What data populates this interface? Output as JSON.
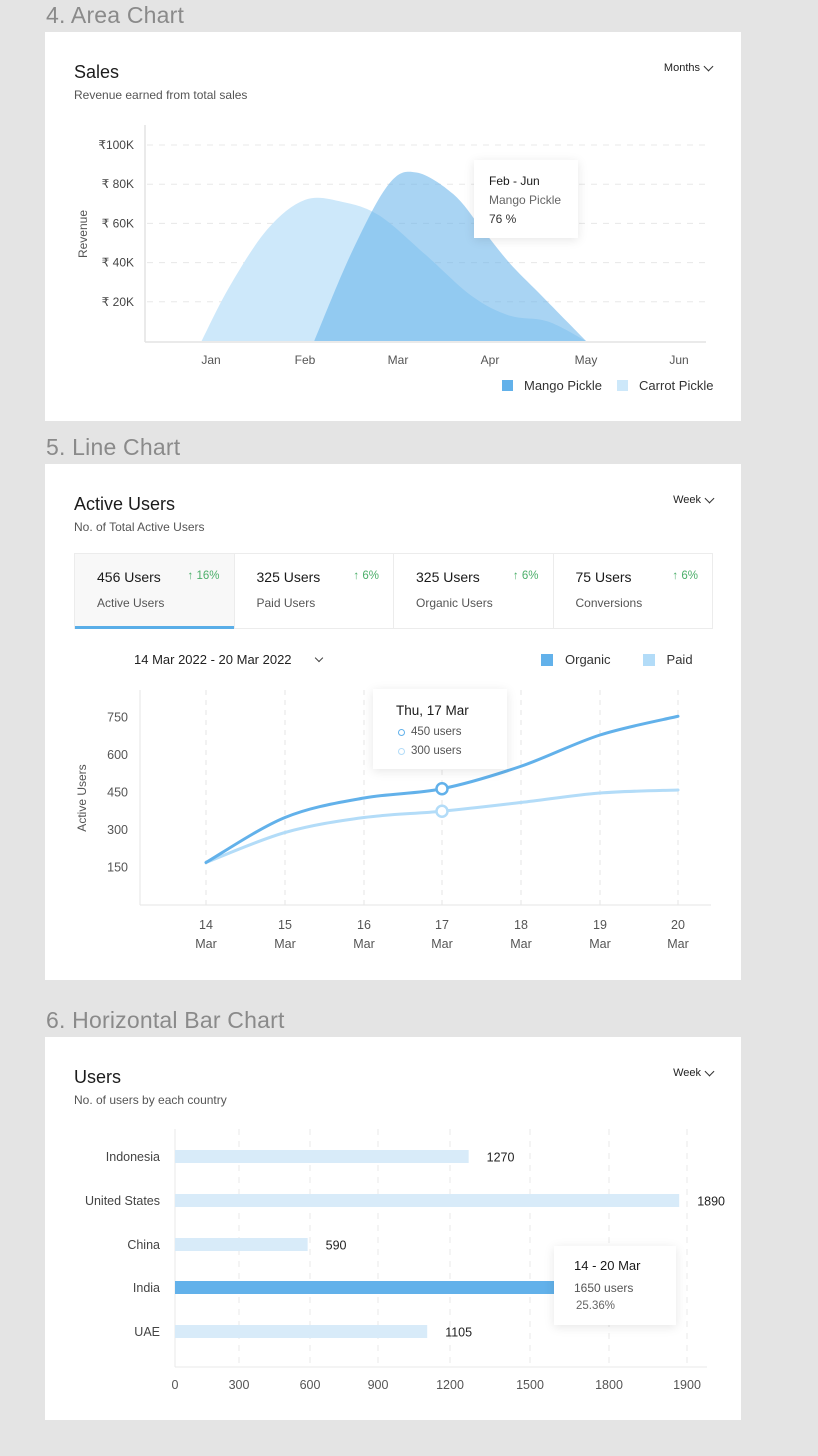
{
  "sections": {
    "area": "4. Area Chart",
    "line": "5. Line Chart",
    "bar": "6. Horizontal Bar Chart"
  },
  "colors": {
    "background": "#e4e4e4",
    "primary_blue": "#62b1ea",
    "light_blue": "#cde8fa",
    "mango_fill": "#8ec9f2",
    "positive": "#4caf6a"
  },
  "area_card": {
    "title": "Sales",
    "subtitle": "Revenue earned from total sales",
    "dropdown": "Months",
    "tooltip": {
      "range": "Feb - Jun",
      "series": "Mango Pickle",
      "value": "76 %"
    }
  },
  "line_card": {
    "title": "Active Users",
    "subtitle": "No. of Total Active Users",
    "dropdown": "Week",
    "date_range": "14 Mar 2022 - 20 Mar 2022",
    "stats": [
      {
        "value": "456 Users",
        "change": "↑ 16%",
        "label": "Active Users",
        "active": true
      },
      {
        "value": "325 Users",
        "change": "↑ 6%",
        "label": "Paid Users"
      },
      {
        "value": "325 Users",
        "change": "↑ 6%",
        "label": "Organic Users"
      },
      {
        "value": "75 Users",
        "change": "↑ 6%",
        "label": "Conversions"
      }
    ],
    "tooltip": {
      "date": "Thu, 17 Mar",
      "organic": "450 users",
      "paid": "300 users"
    }
  },
  "bar_card": {
    "title": "Users",
    "subtitle": "No. of users by each country",
    "dropdown": "Week",
    "tooltip": {
      "range": "14 - 20 Mar",
      "users": "1650 users",
      "percent": "25.36%"
    }
  },
  "chart_data": [
    {
      "type": "area",
      "title": "Sales",
      "subtitle": "Revenue earned from total sales",
      "xlabel": "",
      "ylabel": "Revenue",
      "categories": [
        "Jan",
        "Feb",
        "Mar",
        "Apr",
        "May",
        "Jun"
      ],
      "y_ticks": [
        20000,
        40000,
        60000,
        80000,
        100000
      ],
      "y_tick_labels": [
        "₹ 20K",
        "₹ 40K",
        "₹ 60K",
        "₹ 80K",
        "₹100K"
      ],
      "ylim": [
        0,
        100000
      ],
      "grid": true,
      "legend": "bottom-right",
      "series": [
        {
          "name": "Carrot Pickle",
          "color": "#cde8fa",
          "x": [
            0.9,
            1.2,
            1.6,
            2.0,
            2.4,
            2.8,
            3.3,
            3.8,
            4.2,
            4.6,
            5.0
          ],
          "values": [
            0,
            28000,
            57000,
            72000,
            71000,
            64000,
            44000,
            23000,
            13000,
            10000,
            0
          ]
        },
        {
          "name": "Mango Pickle",
          "color": "#8ec9f2",
          "x": [
            2.1,
            2.5,
            2.9,
            3.2,
            3.6,
            3.9,
            4.2,
            4.5,
            4.8,
            5.0
          ],
          "values": [
            0,
            45000,
            80000,
            86000,
            75000,
            58000,
            40000,
            25000,
            10000,
            0
          ]
        }
      ]
    },
    {
      "type": "line",
      "title": "Active Users",
      "subtitle": "No. of Total Active Users",
      "xlabel": "",
      "ylabel": "Active Users",
      "categories": [
        "14 Mar",
        "15 Mar",
        "16 Mar",
        "17 Mar",
        "18 Mar",
        "19 Mar",
        "20 Mar"
      ],
      "x_day": [
        "14",
        "15",
        "16",
        "17",
        "18",
        "19",
        "20"
      ],
      "x_month": "Mar",
      "y_ticks": [
        150,
        300,
        450,
        600,
        750
      ],
      "ylim": [
        0,
        860
      ],
      "grid": "vertical-dashed",
      "legend": "top-right",
      "highlight_index": 3,
      "series": [
        {
          "name": "Organic",
          "color": "#62b1ea",
          "values": [
            170,
            350,
            428,
            465,
            555,
            680,
            755
          ]
        },
        {
          "name": "Paid",
          "color": "#b3dcf8",
          "values": [
            170,
            290,
            350,
            375,
            410,
            448,
            460
          ]
        }
      ]
    },
    {
      "type": "bar",
      "orientation": "horizontal",
      "title": "Users",
      "subtitle": "No. of users by each country",
      "xlabel": "",
      "ylabel": "",
      "categories": [
        "Indonesia",
        "United States",
        "China",
        "India",
        "UAE"
      ],
      "values": [
        1270,
        1890,
        590,
        1650,
        1105
      ],
      "data_labels": [
        "1270",
        "1890",
        "590",
        "",
        "1105"
      ],
      "highlight_index": 3,
      "x_ticks": [
        0,
        300,
        600,
        900,
        1200,
        1500,
        1800,
        1900
      ],
      "xlim": [
        0,
        1900
      ],
      "grid": "vertical-dashed"
    }
  ]
}
